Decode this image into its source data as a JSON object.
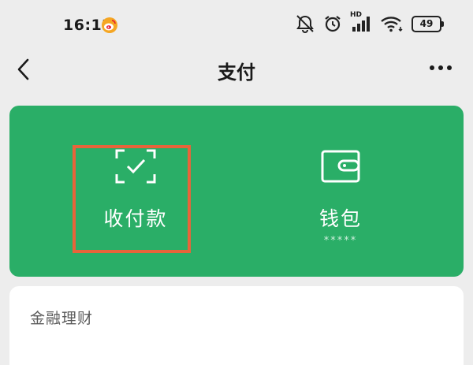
{
  "status_bar": {
    "time": "16:12",
    "battery": "49",
    "network_label": "HD"
  },
  "nav": {
    "title": "支付"
  },
  "pay_card": {
    "receive": {
      "label": "收付款"
    },
    "wallet": {
      "label": "钱包",
      "balance_masked": "*****"
    }
  },
  "sections": [
    {
      "title": "金融理财"
    }
  ],
  "colors": {
    "card_green": "#2aae67",
    "highlight": "#e8643a",
    "background": "#ededed"
  }
}
